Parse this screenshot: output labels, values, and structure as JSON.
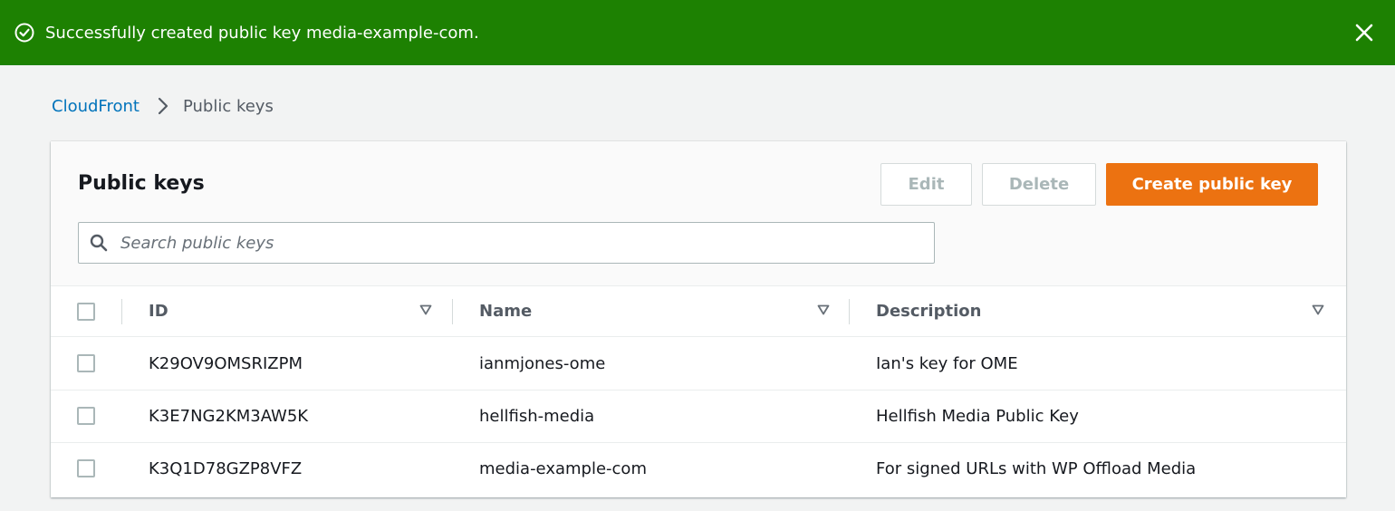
{
  "flash": {
    "message": "Successfully created public key media-example-com.",
    "background": "#1d8102",
    "icon": "check-circle-icon",
    "close_icon": "close-icon"
  },
  "breadcrumb": {
    "root": "CloudFront",
    "current": "Public keys"
  },
  "panel": {
    "title": "Public keys",
    "buttons": {
      "edit": "Edit",
      "delete": "Delete",
      "create": "Create public key"
    },
    "primary_color": "#ec7211",
    "search": {
      "placeholder": "Search public keys",
      "value": ""
    }
  },
  "table": {
    "columns": [
      "ID",
      "Name",
      "Description"
    ],
    "rows": [
      {
        "id": "K29OV9OMSRIZPM",
        "name": "ianmjones-ome",
        "description": "Ian's key for OME"
      },
      {
        "id": "K3E7NG2KM3AW5K",
        "name": "hellfish-media",
        "description": "Hellfish Media Public Key"
      },
      {
        "id": "K3Q1D78GZP8VFZ",
        "name": "media-example-com",
        "description": "For signed URLs with WP Offload Media"
      }
    ]
  }
}
